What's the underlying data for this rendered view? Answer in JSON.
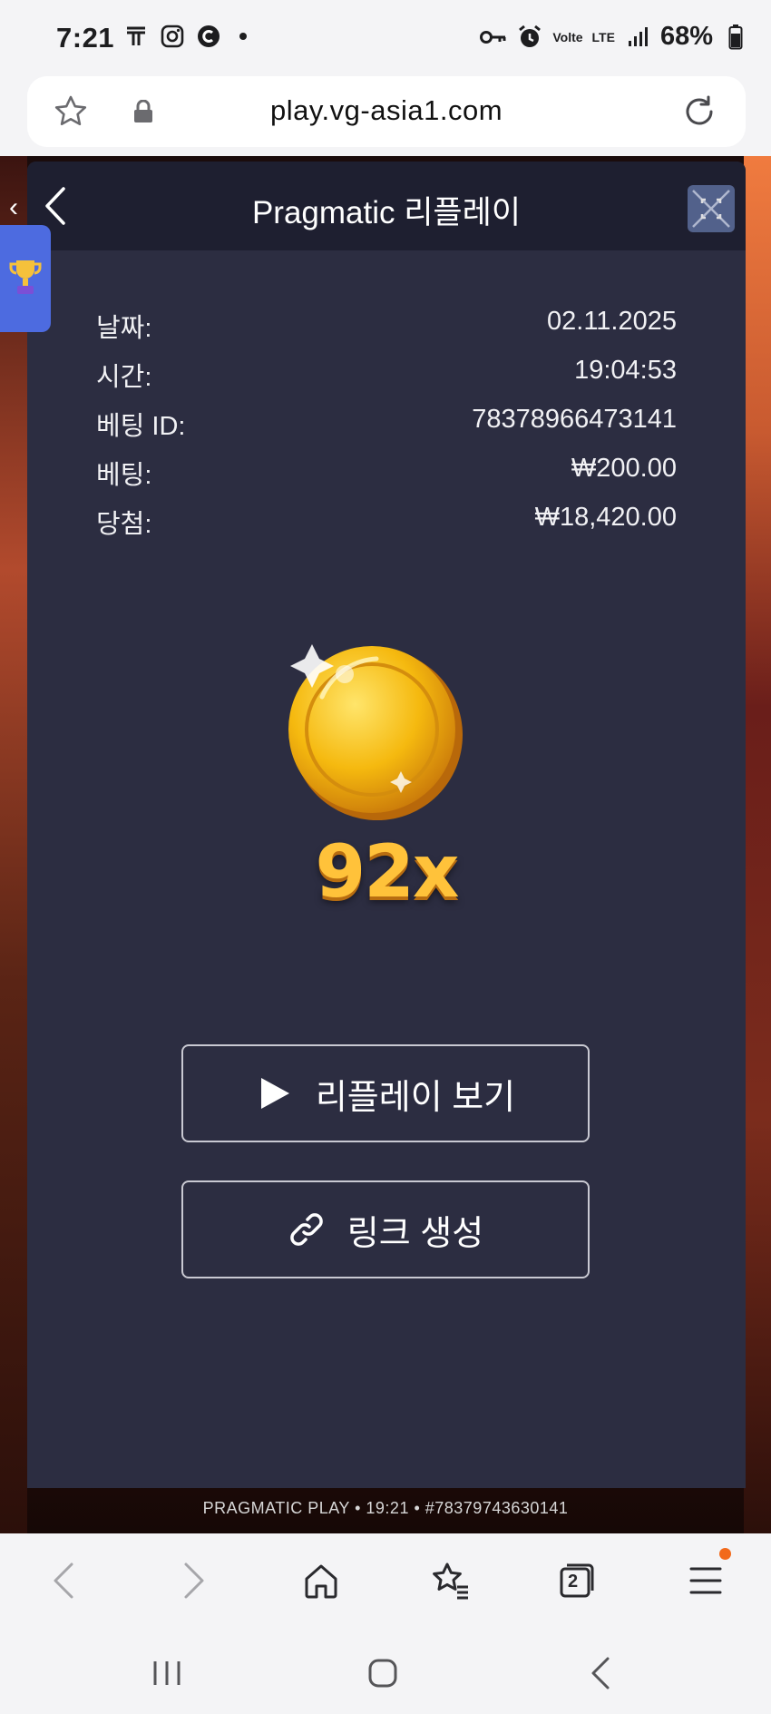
{
  "status_bar": {
    "time": "7:21",
    "network": "LTE",
    "volte": "Volte",
    "battery": "68%",
    "icons": [
      "t-app-icon",
      "instagram-icon",
      "c-app-icon",
      "key-icon",
      "alarm-icon",
      "signal-icon",
      "battery-icon"
    ]
  },
  "browser": {
    "url": "play.vg-asia1.com",
    "tab_count": "2"
  },
  "modal": {
    "title": "Pragmatic 리플레이",
    "details": [
      {
        "label": "날짜:",
        "value": "02.11.2025"
      },
      {
        "label": "시간:",
        "value": "19:04:53"
      },
      {
        "label": "베팅 ID:",
        "value": "78378966473141"
      },
      {
        "label": "베팅:",
        "value": "₩200.00"
      },
      {
        "label": "당첨:",
        "value": "₩18,420.00"
      }
    ],
    "multiplier": "92x",
    "replay_button": "리플레이 보기",
    "link_button": "링크 생성"
  },
  "game": {
    "footer_text": "PRAGMATIC PLAY • 19:21 • #78379743630141"
  },
  "colors": {
    "modal_bg": "#2c2d41",
    "header_bg": "#1e1f30",
    "gold": "#ffc23a",
    "accent_blue": "#4d6be0",
    "badge_orange": "#f26a1b"
  }
}
